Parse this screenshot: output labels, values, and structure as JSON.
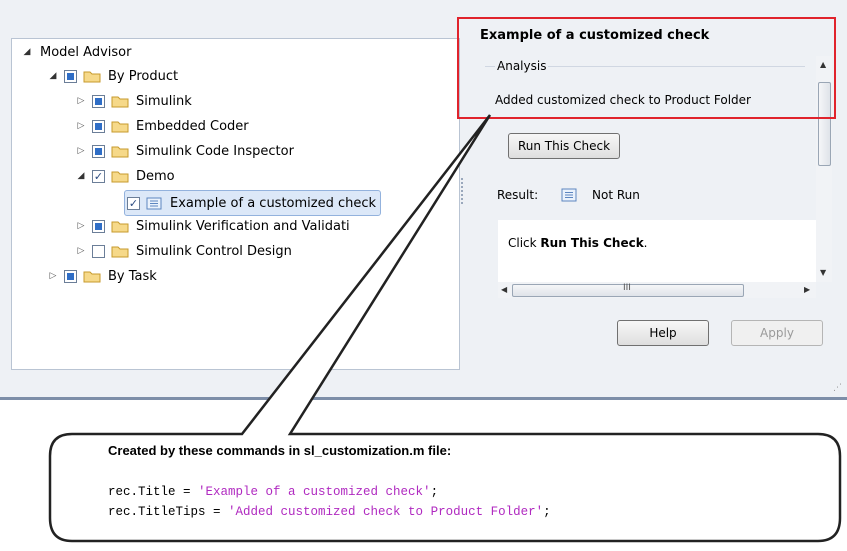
{
  "tree": {
    "root": "Model Advisor",
    "items": [
      {
        "label": "By Product"
      },
      {
        "label": "Simulink"
      },
      {
        "label": "Embedded Coder"
      },
      {
        "label": "Simulink Code Inspector"
      },
      {
        "label": "Demo"
      },
      {
        "label": "Example of a customized check"
      },
      {
        "label": "Simulink Verification and Validati"
      },
      {
        "label": "Simulink Control Design"
      },
      {
        "label": "By Task"
      }
    ]
  },
  "details": {
    "title": "Example of a customized check",
    "analysis_label": "Analysis",
    "analysis_text": "Added customized check to Product Folder",
    "run_button": "Run This Check",
    "result_label": "Result:",
    "result_value": "Not Run",
    "instruction_prefix": "Click ",
    "instruction_bold": "Run This Check",
    "instruction_suffix": ".",
    "hscroll_marker": "III"
  },
  "buttons": {
    "help": "Help",
    "apply": "Apply"
  },
  "callout": {
    "heading": "Created by these commands in sl_customization.m file:",
    "line1_prefix": "rec.Title = ",
    "line1_string": "'Example of a customized check'",
    "line1_suffix": ";",
    "line2_prefix": "rec.TitleTips = ",
    "line2_string": "'Added customized check to Product Folder'",
    "line2_suffix": ";"
  },
  "colors": {
    "highlight_box": "#e0232c",
    "code_string": "#b02ac0",
    "checkbox_fill": "#2f6ec7"
  }
}
